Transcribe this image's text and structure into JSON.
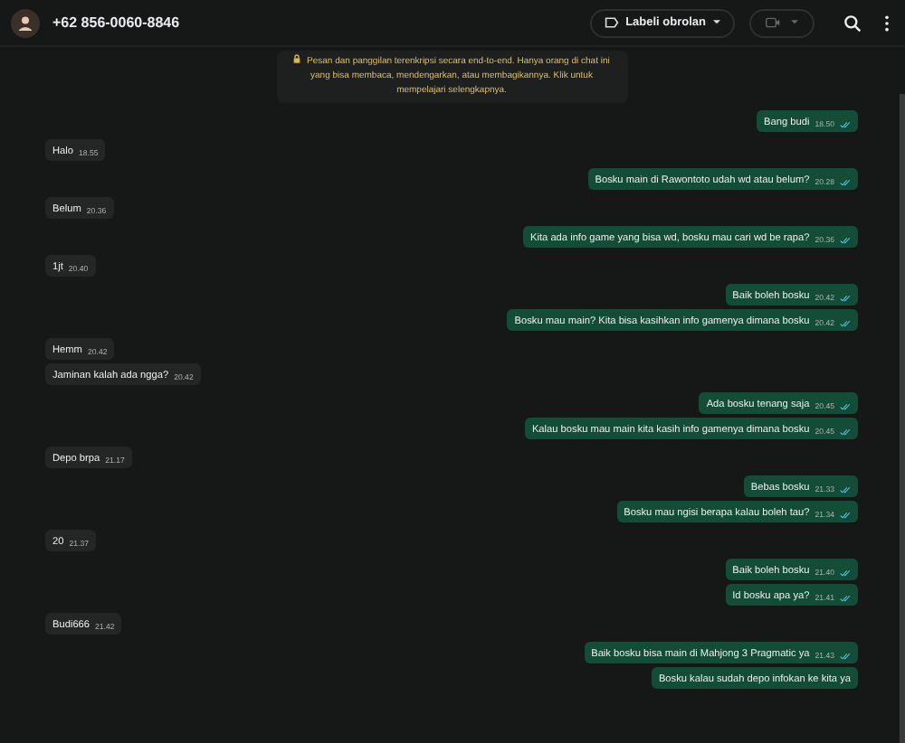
{
  "header": {
    "contact": "+62 856-0060-8846",
    "label_button": "Labeli obrolan"
  },
  "notice": "Pesan dan panggilan terenkripsi secara end-to-end. Hanya orang di chat ini yang bisa membaca, mendengarkan, atau membagikannya. Klik untuk mempelajari selengkapnya.",
  "groups": [
    {
      "kind": "sent",
      "messages": [
        {
          "text": "Bang budi",
          "time": "18.50",
          "read": true
        }
      ]
    },
    {
      "kind": "received",
      "messages": [
        {
          "text": "Halo",
          "time": "18.55"
        }
      ]
    },
    {
      "kind": "sent",
      "messages": [
        {
          "text": "Bosku main di Rawontoto udah wd atau belum?",
          "time": "20.28",
          "read": true
        }
      ]
    },
    {
      "kind": "received",
      "messages": [
        {
          "text": "Belum",
          "time": "20.36"
        }
      ]
    },
    {
      "kind": "sent",
      "messages": [
        {
          "text": "Kita ada info game yang bisa wd, bosku mau cari wd be rapa?",
          "time": "20.36",
          "read": true
        }
      ]
    },
    {
      "kind": "received",
      "messages": [
        {
          "text": "1jt",
          "time": "20.40"
        }
      ]
    },
    {
      "kind": "sent",
      "messages": [
        {
          "text": "Baik boleh bosku",
          "time": "20.42",
          "read": true
        },
        {
          "text": "Bosku mau main? Kita bisa kasihkan info gamenya dimana bosku",
          "time": "20.42",
          "read": true
        }
      ]
    },
    {
      "kind": "received",
      "messages": [
        {
          "text": "Hemm",
          "time": "20.42"
        },
        {
          "text": "Jaminan kalah ada ngga?",
          "time": "20.42"
        }
      ]
    },
    {
      "kind": "sent",
      "messages": [
        {
          "text": "Ada bosku tenang saja",
          "time": "20.45",
          "read": true
        },
        {
          "text": "Kalau bosku mau main kita kasih info gamenya dimana bosku",
          "time": "20.45",
          "read": true
        }
      ]
    },
    {
      "kind": "received",
      "messages": [
        {
          "text": "Depo brpa",
          "time": "21.17"
        }
      ]
    },
    {
      "kind": "sent",
      "messages": [
        {
          "text": "Bebas bosku",
          "time": "21.33",
          "read": true
        },
        {
          "text": "Bosku mau ngisi berapa kalau boleh tau?",
          "time": "21.34",
          "read": true
        }
      ]
    },
    {
      "kind": "received",
      "messages": [
        {
          "text": "20",
          "time": "21.37"
        }
      ]
    },
    {
      "kind": "sent",
      "messages": [
        {
          "text": "Baik boleh bosku",
          "time": "21.40",
          "read": true
        },
        {
          "text": "Id bosku apa ya?",
          "time": "21.41",
          "read": true
        }
      ]
    },
    {
      "kind": "received",
      "messages": [
        {
          "text": "Budi666",
          "time": "21.42"
        }
      ]
    },
    {
      "kind": "sent",
      "messages": [
        {
          "text": "Baik bosku bisa main di Mahjong 3 Pragmatic ya",
          "time": "21.43",
          "read": true
        },
        {
          "text": "Bosku kalau sudah depo infokan ke kita ya"
        }
      ]
    }
  ]
}
